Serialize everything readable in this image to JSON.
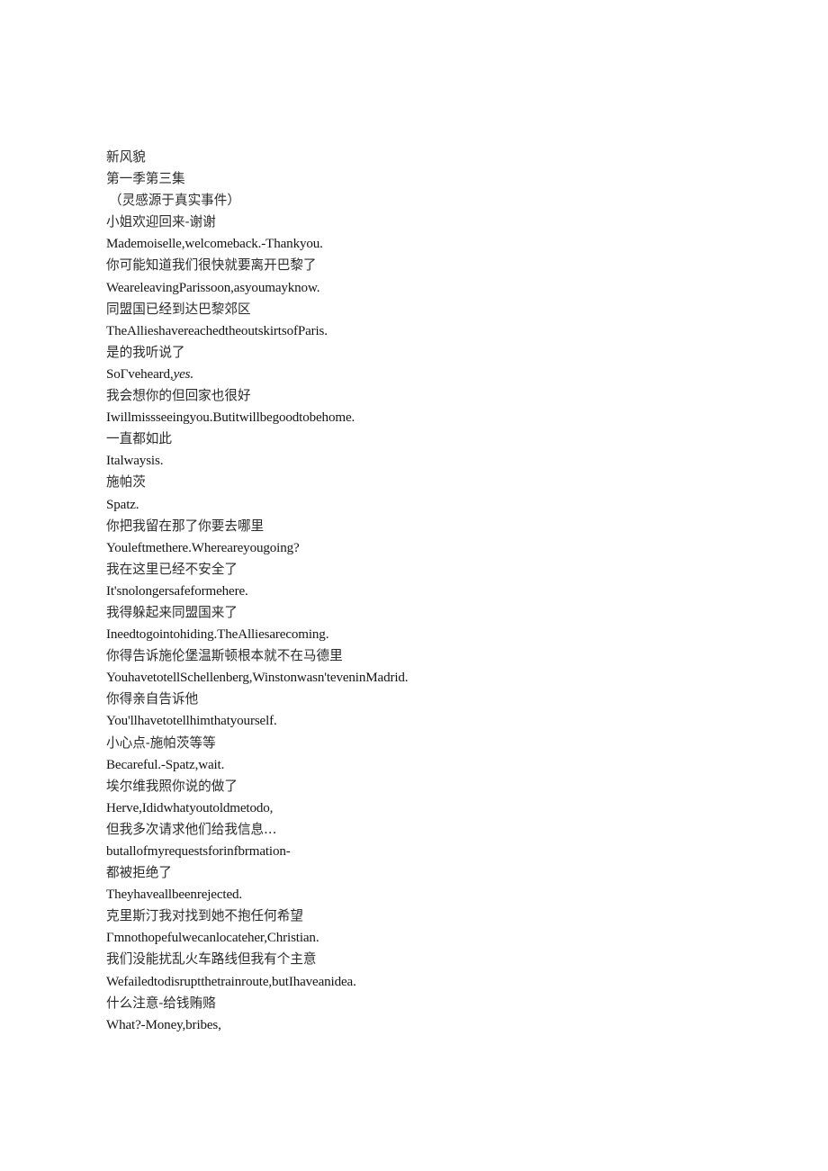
{
  "document": {
    "title": "新风貌",
    "subtitle": "第一季第三集",
    "note": "（灵感源于真实事件）",
    "lines": [
      {
        "id": "title",
        "script": "cjk",
        "indent": false,
        "text": "新风貌"
      },
      {
        "id": "episode",
        "script": "cjk",
        "indent": false,
        "text": "第一季第三集"
      },
      {
        "id": "based-on",
        "script": "cjk",
        "indent": true,
        "text": "（灵感源于真实事件）"
      },
      {
        "id": "cue-01-zh",
        "script": "cjk",
        "indent": false,
        "text": "小姐欢迎回来-谢谢"
      },
      {
        "id": "cue-01-en",
        "script": "latin",
        "indent": false,
        "text": "Mademoiselle,welcomeback.-Thankyou."
      },
      {
        "id": "cue-02-zh",
        "script": "cjk",
        "indent": false,
        "text": "你可能知道我们很快就要离开巴黎了"
      },
      {
        "id": "cue-02-en",
        "script": "latin",
        "indent": false,
        "text": "WeareleavingParissoon,asyoumayknow."
      },
      {
        "id": "cue-03-zh",
        "script": "cjk",
        "indent": false,
        "text": "同盟国已经到达巴黎郊区"
      },
      {
        "id": "cue-03-en",
        "script": "latin",
        "indent": false,
        "text": "TheAllieshavereachedtheoutskirtsofParis."
      },
      {
        "id": "cue-04-zh",
        "script": "cjk",
        "indent": false,
        "text": "是的我听说了"
      },
      {
        "id": "cue-04-en",
        "script": "latin",
        "indent": false,
        "html": "SoΓveheard,<em>yes.</em>",
        "text": "SoΓveheard,yes."
      },
      {
        "id": "cue-05-zh",
        "script": "cjk",
        "indent": false,
        "text": "我会想你的但回家也很好"
      },
      {
        "id": "cue-05-en",
        "script": "latin",
        "indent": false,
        "text": "Iwillmissseeingyou.Butitwillbegoodtobehome."
      },
      {
        "id": "cue-06-zh",
        "script": "cjk",
        "indent": false,
        "text": "一直都如此"
      },
      {
        "id": "cue-06-en",
        "script": "latin",
        "indent": false,
        "text": "Italwaysis."
      },
      {
        "id": "cue-07-zh",
        "script": "cjk",
        "indent": false,
        "text": "施帕茨"
      },
      {
        "id": "cue-07-en",
        "script": "latin",
        "indent": false,
        "text": "Spatz."
      },
      {
        "id": "cue-08-zh",
        "script": "cjk",
        "indent": false,
        "text": "你把我留在那了你要去哪里"
      },
      {
        "id": "cue-08-en",
        "script": "latin",
        "indent": false,
        "text": "Youleftmethere.Whereareyougoing?"
      },
      {
        "id": "cue-09-zh",
        "script": "cjk",
        "indent": false,
        "text": "我在这里已经不安全了"
      },
      {
        "id": "cue-09-en",
        "script": "latin",
        "indent": false,
        "text": "It'snolongersafeformehere."
      },
      {
        "id": "cue-10-zh",
        "script": "cjk",
        "indent": false,
        "text": "我得躲起来同盟国来了"
      },
      {
        "id": "cue-10-en",
        "script": "latin",
        "indent": false,
        "text": "Ineedtogointohiding.TheAlliesarecoming."
      },
      {
        "id": "cue-11-zh",
        "script": "cjk",
        "indent": false,
        "text": "你得告诉施伦堡温斯顿根本就不在马德里"
      },
      {
        "id": "cue-11-en",
        "script": "latin",
        "indent": false,
        "text": "YouhavetotellSchellenberg,Winstonwasn'teveninMadrid."
      },
      {
        "id": "cue-12-zh",
        "script": "cjk",
        "indent": false,
        "text": "你得亲自告诉他"
      },
      {
        "id": "cue-12-en",
        "script": "latin",
        "indent": false,
        "text": "You'llhavetotellhimthatyourself."
      },
      {
        "id": "cue-13-zh",
        "script": "cjk",
        "indent": false,
        "text": "小心点-施帕茨等等"
      },
      {
        "id": "cue-13-en",
        "script": "latin",
        "indent": false,
        "text": "Becareful.-Spatz,wait."
      },
      {
        "id": "cue-14-zh",
        "script": "cjk",
        "indent": false,
        "text": "埃尔维我照你说的做了"
      },
      {
        "id": "cue-14-en",
        "script": "latin",
        "indent": false,
        "text": "Herve,Ididwhatyoutoldmetodo,"
      },
      {
        "id": "cue-15-zh",
        "script": "cjk",
        "indent": false,
        "text": "但我多次请求他们给我信息.‥"
      },
      {
        "id": "cue-15-en",
        "script": "latin",
        "indent": false,
        "text": "butallofmyrequestsforinfbrmation-"
      },
      {
        "id": "cue-16-zh",
        "script": "cjk",
        "indent": false,
        "text": "都被拒绝了"
      },
      {
        "id": "cue-16-en",
        "script": "latin",
        "indent": false,
        "text": "Theyhaveallbeenrejected."
      },
      {
        "id": "cue-17-zh",
        "script": "cjk",
        "indent": false,
        "text": "克里斯汀我对找到她不抱任何希望"
      },
      {
        "id": "cue-17-en",
        "script": "latin",
        "indent": false,
        "text": "Γmnothopefulwecanlocateher,Christian."
      },
      {
        "id": "cue-18-zh",
        "script": "cjk",
        "indent": false,
        "text": "我们没能扰乱火车路线但我有个主意"
      },
      {
        "id": "cue-18-en",
        "script": "latin",
        "indent": false,
        "text": "Wefailedtodisruptthetrainroute,butIhaveanidea."
      },
      {
        "id": "cue-19-zh",
        "script": "cjk",
        "indent": false,
        "text": "什么注意-给钱贿赂"
      },
      {
        "id": "cue-19-en",
        "script": "latin",
        "indent": false,
        "text": "What?-Money,bribes,"
      }
    ]
  },
  "style": {
    "page_background": "#ffffff",
    "cjk_text_color": "#2b2b2b",
    "latin_text_color": "#141414"
  }
}
